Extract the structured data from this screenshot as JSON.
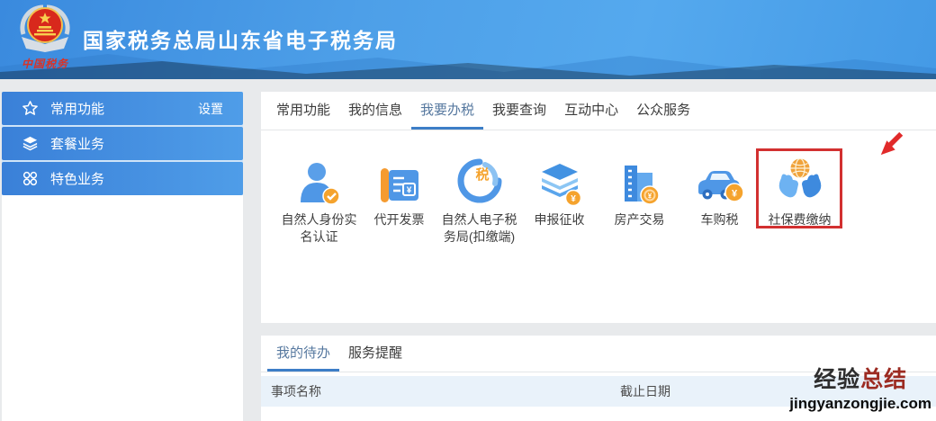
{
  "header": {
    "title": "国家税务总局山东省电子税务局",
    "logo_caption": "中国税务"
  },
  "sidebar": {
    "items": [
      {
        "label": "常用功能",
        "icon": "star-icon",
        "action": "设置"
      },
      {
        "label": "套餐业务",
        "icon": "layers-icon"
      },
      {
        "label": "特色业务",
        "icon": "grid-circles-icon"
      }
    ]
  },
  "nav_tabs": [
    {
      "label": "常用功能",
      "active": false
    },
    {
      "label": "我的信息",
      "active": false
    },
    {
      "label": "我要办税",
      "active": true
    },
    {
      "label": "我要查询",
      "active": false
    },
    {
      "label": "互动中心",
      "active": false
    },
    {
      "label": "公众服务",
      "active": false
    }
  ],
  "services": [
    {
      "label": "自然人身份实名认证",
      "icon": "person-verified-icon"
    },
    {
      "label": "代开发票",
      "icon": "invoice-icon"
    },
    {
      "label": "自然人电子税务局(扣缴端)",
      "icon": "tax-circle-icon"
    },
    {
      "label": "申报征收",
      "icon": "layers-yen-icon"
    },
    {
      "label": "房产交易",
      "icon": "building-coin-icon"
    },
    {
      "label": "车购税",
      "icon": "car-yen-icon"
    },
    {
      "label": "社保费缴纳",
      "icon": "hands-globe-icon",
      "highlighted": true
    }
  ],
  "icon_glyphs": {
    "yen": "¥",
    "tax": "税"
  },
  "tasks": {
    "tabs": [
      {
        "label": "我的待办",
        "active": true
      },
      {
        "label": "服务提醒",
        "active": false
      }
    ],
    "columns": [
      "事项名称",
      "截止日期"
    ],
    "rows": []
  },
  "watermark": {
    "title_black": "经验",
    "title_red": "总结",
    "url": "jingyanzongjie.com"
  },
  "colors": {
    "header_blue": "#4a9ce6",
    "sidebar_blue": "#3d86db",
    "active_tab_underline": "#3d7ec7",
    "badge_orange": "#f5a32d",
    "highlight_red": "#d23030",
    "table_header_bg": "#e9f2fa"
  }
}
